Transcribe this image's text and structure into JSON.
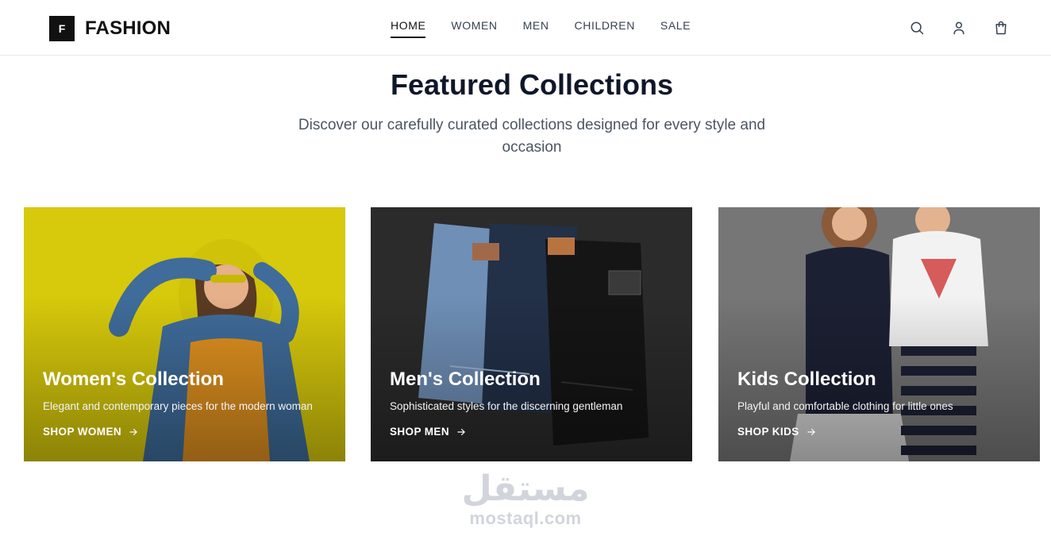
{
  "brand": {
    "mark": "F",
    "name": "FASHION"
  },
  "nav": [
    {
      "label": "HOME",
      "active": true
    },
    {
      "label": "WOMEN"
    },
    {
      "label": "MEN"
    },
    {
      "label": "CHILDREN"
    },
    {
      "label": "SALE"
    }
  ],
  "header_icons": [
    "search-icon",
    "user-icon",
    "shopping-bag-icon"
  ],
  "featured": {
    "title": "Featured Collections",
    "subtitle": "Discover our carefully curated collections designed for every style and occasion"
  },
  "collections": [
    {
      "title": "Women's Collection",
      "description": "Elegant and contemporary pieces for the modern woman",
      "link": "SHOP WOMEN",
      "bg": "#d6c80a"
    },
    {
      "title": "Men's Collection",
      "description": "Sophisticated styles for the discerning gentleman",
      "link": "SHOP MEN",
      "bg": "#2a2a2a"
    },
    {
      "title": "Kids Collection",
      "description": "Playful and comfortable clothing for little ones",
      "link": "SHOP KIDS",
      "bg": "#7a7a7a"
    }
  ],
  "watermark": {
    "arabic": "مستقل",
    "latin": "mostaql.com"
  }
}
